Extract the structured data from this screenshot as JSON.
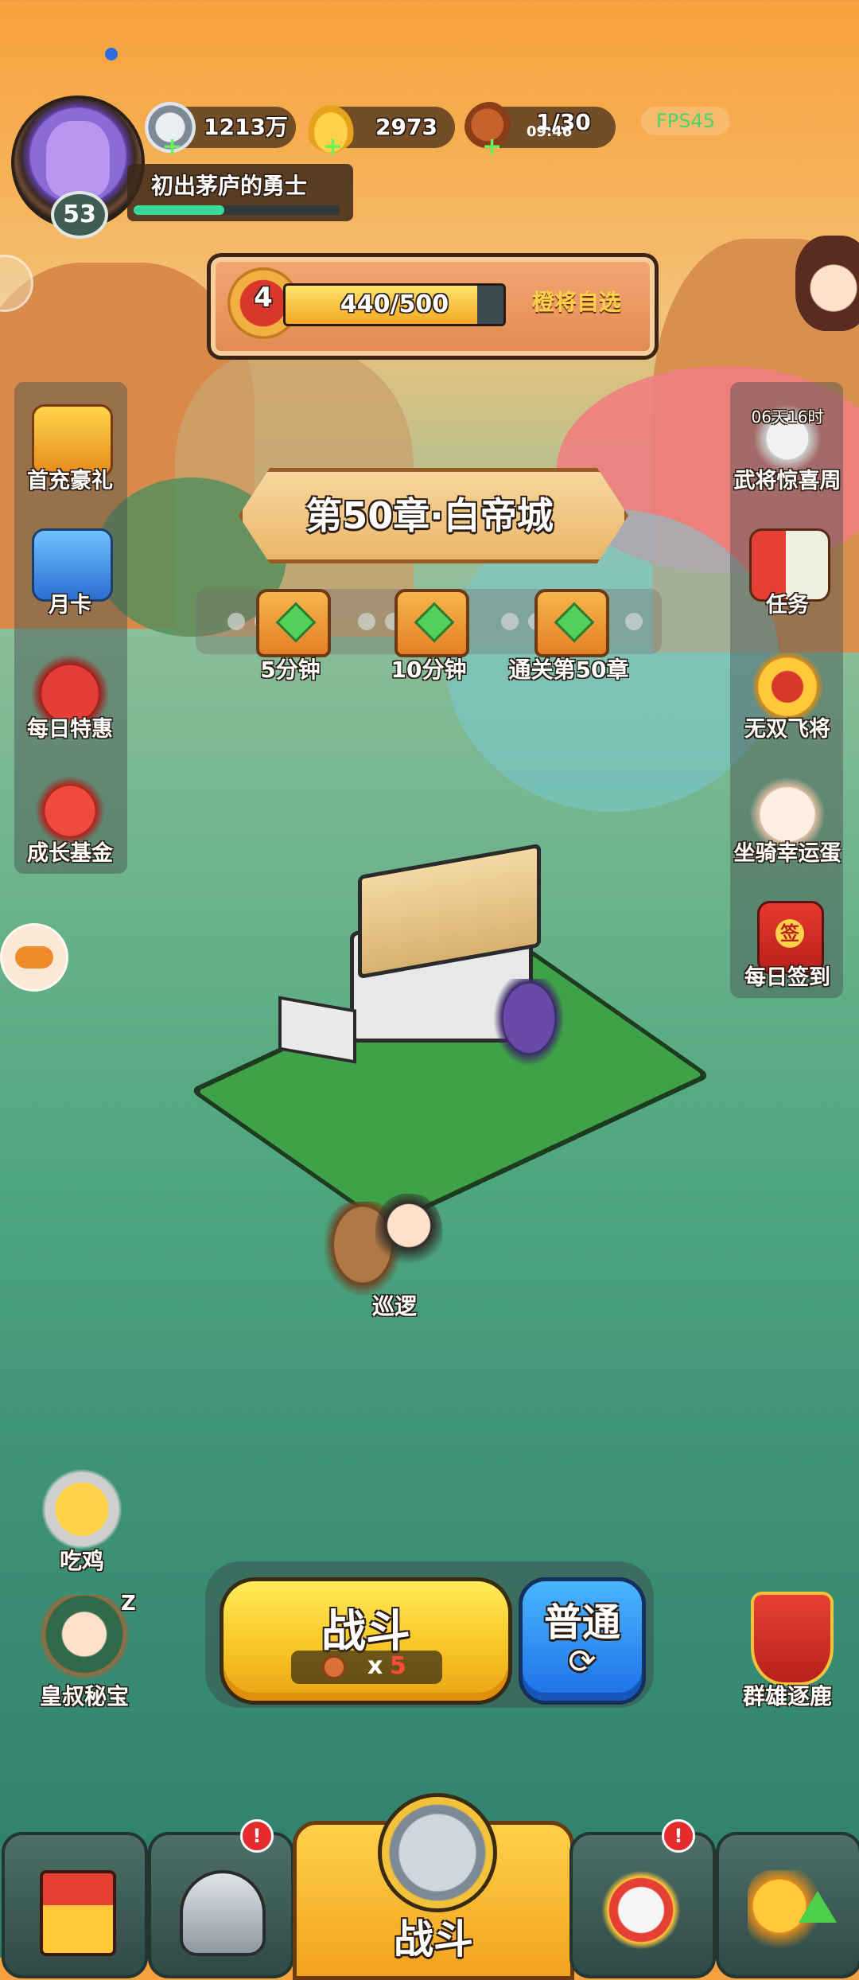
{
  "top_bar": {
    "player_level": "53",
    "player_title": "初出茅庐的勇士",
    "silver": "1213万",
    "gold": "2973",
    "stamina": "1/30",
    "stamina_timer": "09:46",
    "fps": "FPS45"
  },
  "quest": {
    "level": "4",
    "progress_text": "440/500",
    "progress_value": 0.88,
    "reward_label": "橙将自选"
  },
  "left_menu": [
    {
      "label": "首充豪礼",
      "icon": "treasure-chest-icon"
    },
    {
      "label": "月卡",
      "icon": "month-card-icon"
    },
    {
      "label": "每日特惠",
      "icon": "gift-bag-icon"
    },
    {
      "label": "成长基金",
      "icon": "fund-icon"
    }
  ],
  "right_menu": [
    {
      "label": "武将惊喜周",
      "timer": "06天16时",
      "icon": "sage-icon"
    },
    {
      "label": "任务",
      "icon": "scroll-icon"
    },
    {
      "label": "无双飞将",
      "icon": "emblem-icon"
    },
    {
      "label": "坐骑幸运蛋",
      "icon": "panda-egg-icon"
    },
    {
      "label": "每日签到",
      "icon": "sign-in-icon",
      "stamp": "签"
    }
  ],
  "chapter": {
    "title": "第50章·白帝城",
    "chests": [
      "5分钟",
      "10分钟",
      "通关第50章"
    ]
  },
  "patrol": {
    "label": "巡逻"
  },
  "side_extras": {
    "chicken": "吃鸡",
    "uncle_treasure": "皇叔秘宝",
    "sleep_z": "Z",
    "heroes_hunt": "群雄逐鹿"
  },
  "battle": {
    "button_label": "战斗",
    "cost_prefix": "x",
    "cost_value": "5",
    "mode_label": "普通"
  },
  "bottom_nav": {
    "center_label": "战斗",
    "badge": "!"
  },
  "colors": {
    "sky": "#f7a13c",
    "grass": "#4ea67f",
    "battle_yellow": "#f7c223",
    "mode_blue": "#1d6fe6",
    "alert_red": "#e52b2b"
  }
}
